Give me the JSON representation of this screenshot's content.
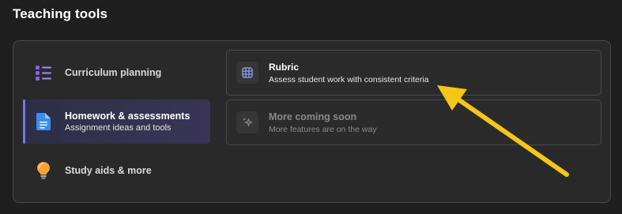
{
  "page": {
    "title": "Teaching tools"
  },
  "sidebar": {
    "items": [
      {
        "label": "Curriculum planning",
        "icon": "list-icon"
      },
      {
        "label": "Homework & assessments",
        "subtitle": "Assignment ideas and tools",
        "icon": "document-icon",
        "selected": true
      },
      {
        "label": "Study aids & more",
        "icon": "lightbulb-icon"
      }
    ]
  },
  "cards": [
    {
      "title": "Rubric",
      "subtitle": "Assess student work with consistent criteria",
      "icon": "grid-icon"
    },
    {
      "title": "More coming soon",
      "subtitle": "More features are on the way",
      "icon": "sparkle-icon",
      "disabled": true
    }
  ],
  "colors": {
    "background": "#1f1f1f",
    "panel": "#292929",
    "accent": "#7b74e8",
    "selected_bg": "#34334f",
    "annotation_arrow": "#f5c518"
  }
}
